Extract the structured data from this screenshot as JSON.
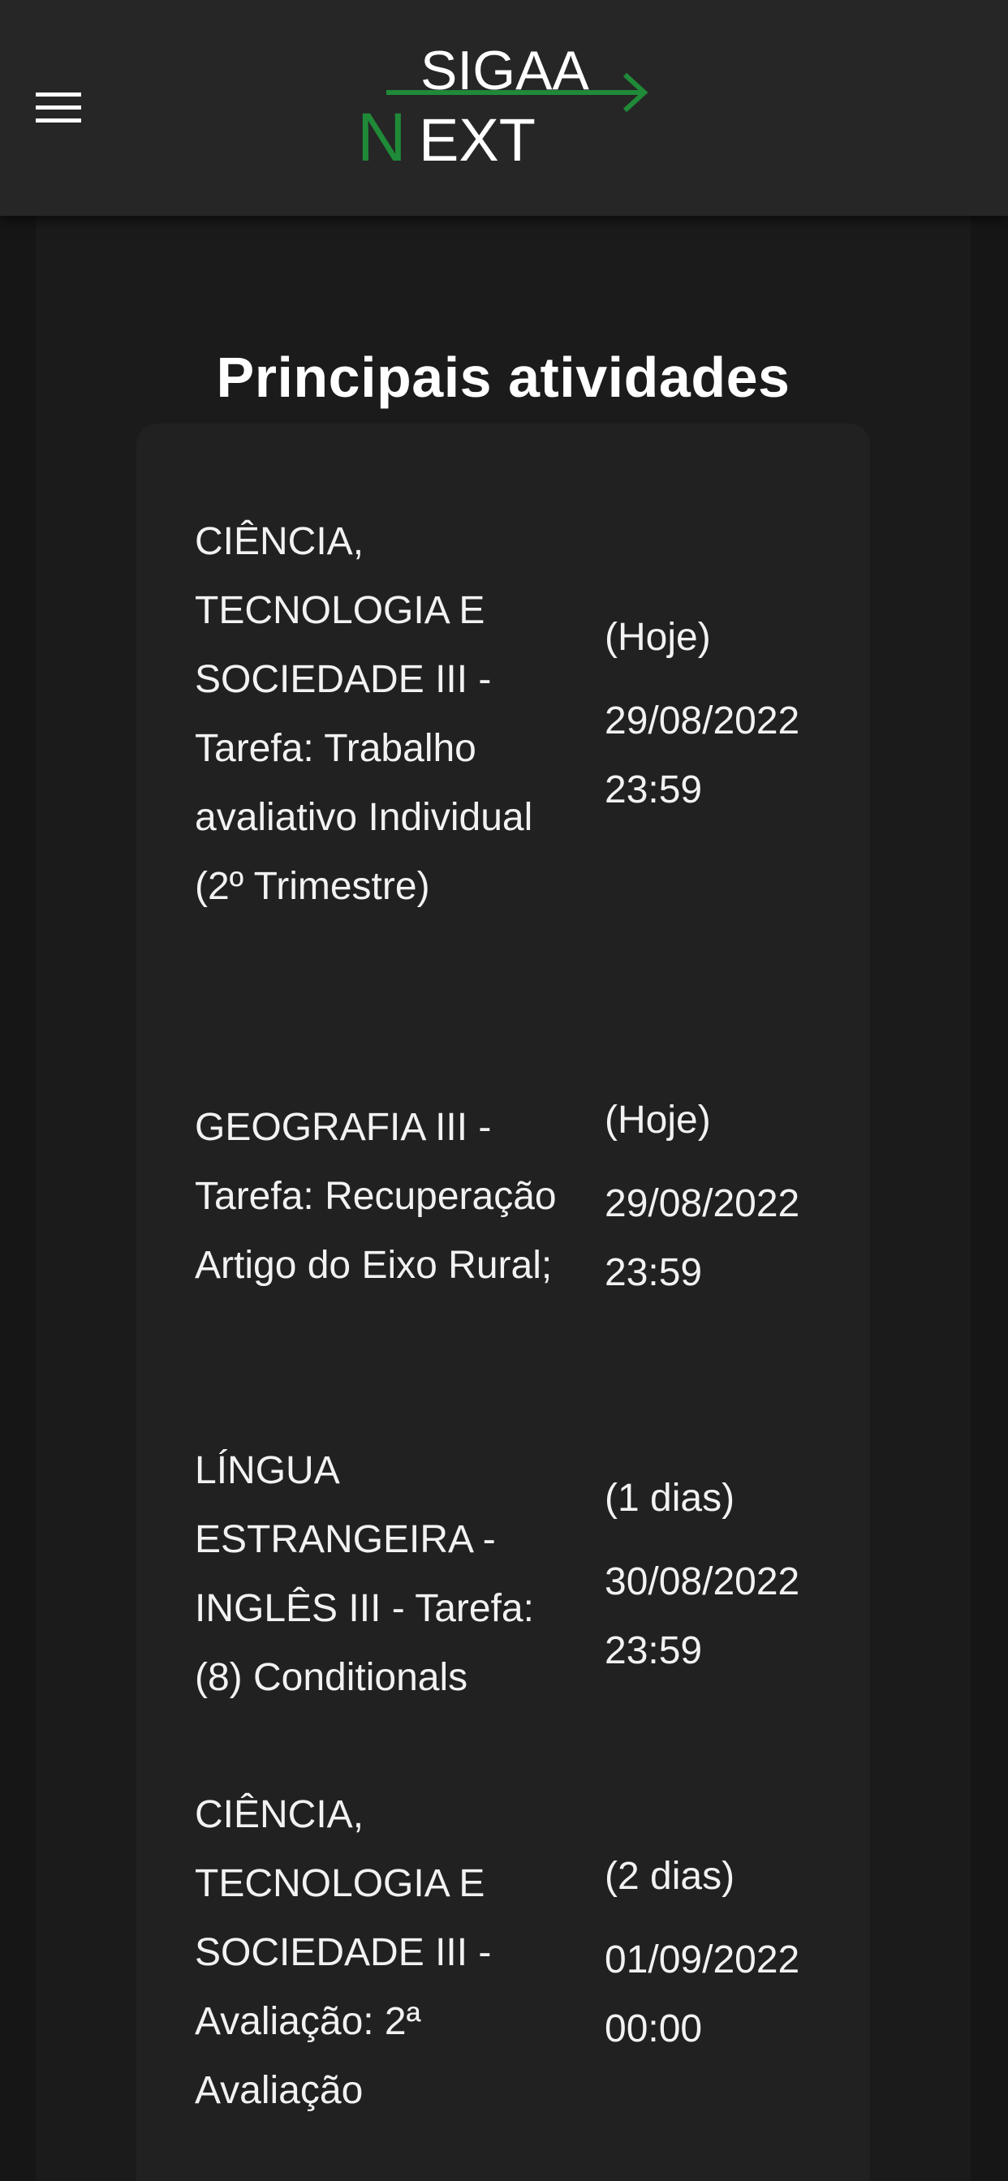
{
  "header": {
    "logo_top": "SIGAA",
    "logo_n": "N",
    "logo_rest": "EXT",
    "colors": {
      "logo_green": "#1f8a38",
      "logo_text": "#ffffff",
      "bar": "#262626"
    }
  },
  "main": {
    "title": "Principais atividades",
    "activities": [
      {
        "title": "CIÊNCIA, TECNOLOGIA E SOCIEDADE III - Tarefa: Trabalho avaliativo Individual (2º Trimestre)",
        "relative": "(Hoje)",
        "date": "29/08/2022 23:59"
      },
      {
        "title": "GEOGRAFIA III - Tarefa: Recuperação Artigo do Eixo Rural;",
        "relative": "(Hoje)",
        "date": "29/08/2022 23:59"
      },
      {
        "title": "LÍNGUA ESTRANGEIRA - INGLÊS III - Tarefa: (8) Conditionals",
        "relative": "(1 dias)",
        "date": "30/08/2022 23:59"
      },
      {
        "title": "CIÊNCIA, TECNOLOGIA E SOCIEDADE III - Avaliação: 2ª Avaliação",
        "relative": "(2 dias)",
        "date": "01/09/2022 00:00"
      }
    ]
  }
}
